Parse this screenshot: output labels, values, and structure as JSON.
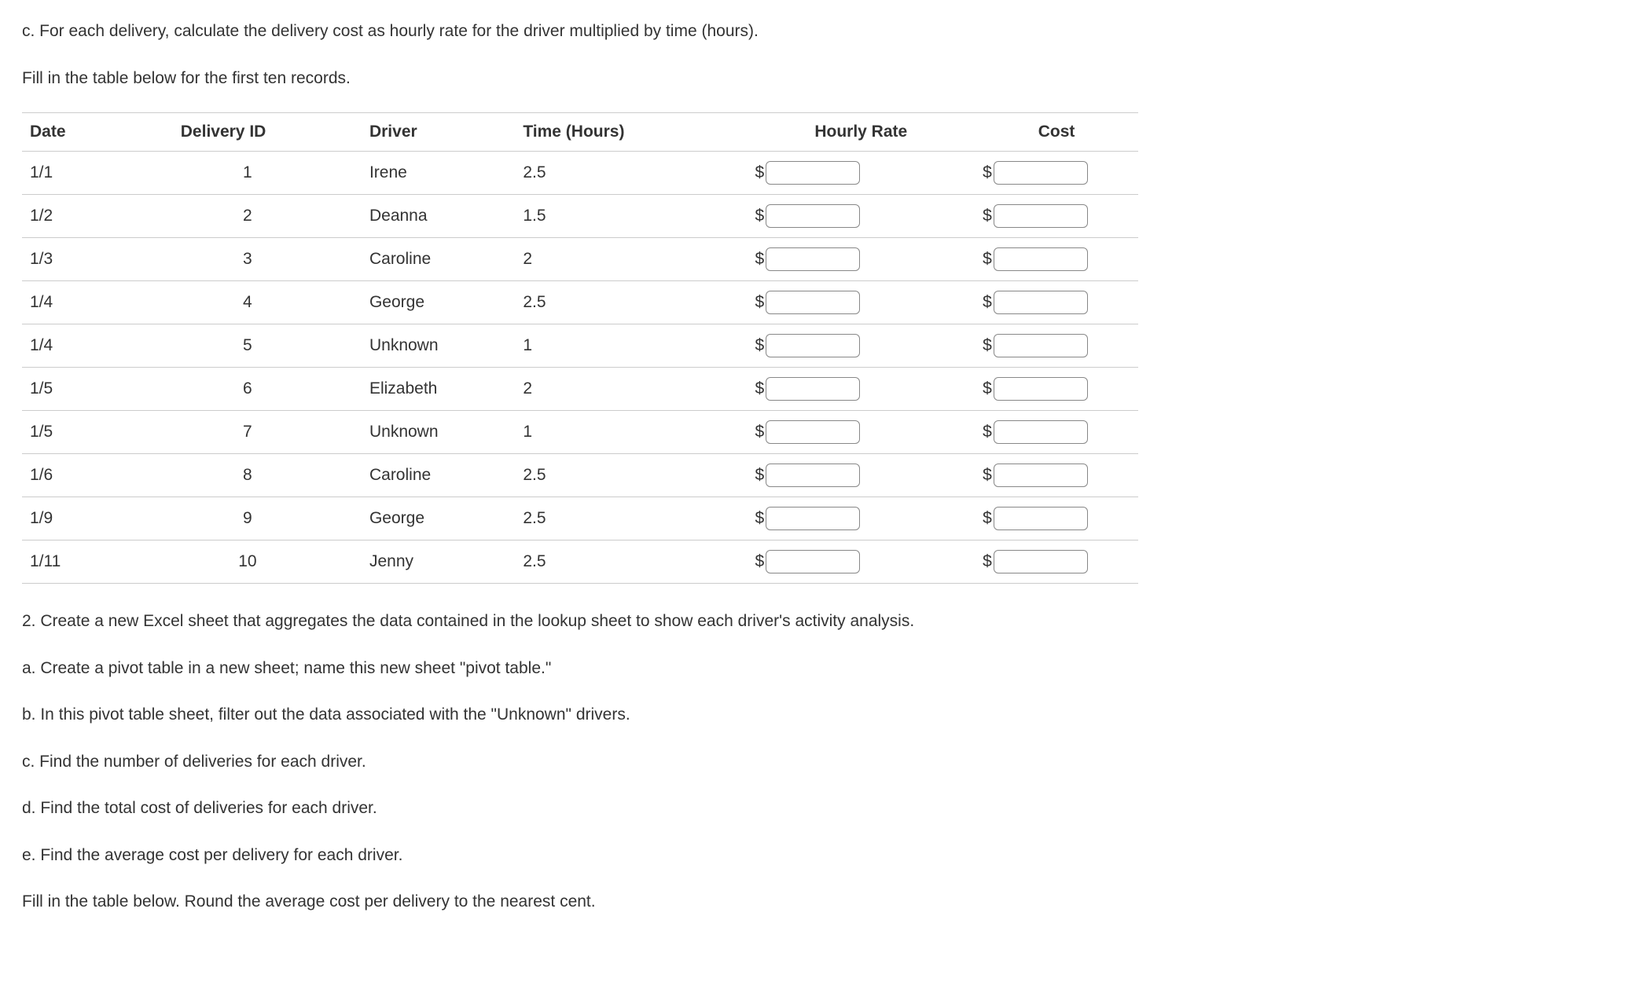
{
  "intro": {
    "line_c": "c. For each delivery, calculate the delivery cost as hourly rate for the driver multiplied by time (hours).",
    "fill_in": "Fill in the table below for the first ten records."
  },
  "table": {
    "headers": {
      "date": "Date",
      "delivery_id": "Delivery ID",
      "driver": "Driver",
      "time": "Time (Hours)",
      "hourly_rate": "Hourly Rate",
      "cost": "Cost"
    },
    "currency_symbol": "$",
    "rows": [
      {
        "date": "1/1",
        "id": "1",
        "driver": "Irene",
        "time": "2.5",
        "rate": "",
        "cost": ""
      },
      {
        "date": "1/2",
        "id": "2",
        "driver": "Deanna",
        "time": "1.5",
        "rate": "",
        "cost": ""
      },
      {
        "date": "1/3",
        "id": "3",
        "driver": "Caroline",
        "time": "2",
        "rate": "",
        "cost": ""
      },
      {
        "date": "1/4",
        "id": "4",
        "driver": "George",
        "time": "2.5",
        "rate": "",
        "cost": ""
      },
      {
        "date": "1/4",
        "id": "5",
        "driver": "Unknown",
        "time": "1",
        "rate": "",
        "cost": ""
      },
      {
        "date": "1/5",
        "id": "6",
        "driver": "Elizabeth",
        "time": "2",
        "rate": "",
        "cost": ""
      },
      {
        "date": "1/5",
        "id": "7",
        "driver": "Unknown",
        "time": "1",
        "rate": "",
        "cost": ""
      },
      {
        "date": "1/6",
        "id": "8",
        "driver": "Caroline",
        "time": "2.5",
        "rate": "",
        "cost": ""
      },
      {
        "date": "1/9",
        "id": "9",
        "driver": "George",
        "time": "2.5",
        "rate": "",
        "cost": ""
      },
      {
        "date": "1/11",
        "id": "10",
        "driver": "Jenny",
        "time": "2.5",
        "rate": "",
        "cost": ""
      }
    ]
  },
  "instructions": {
    "q2": "2. Create a new Excel sheet that aggregates the data contained in the lookup sheet to show each driver's activity analysis.",
    "a": "a. Create a pivot table in a new sheet; name this new sheet \"pivot table.\"",
    "b": "b. In this pivot table sheet, filter out the data associated with the \"Unknown\" drivers.",
    "c": "c. Find the number of deliveries for each driver.",
    "d": "d. Find the total cost of deliveries for each driver.",
    "e": "e. Find the average cost per delivery for each driver.",
    "fill": "Fill in the table below. Round the average cost per delivery to the nearest cent."
  }
}
